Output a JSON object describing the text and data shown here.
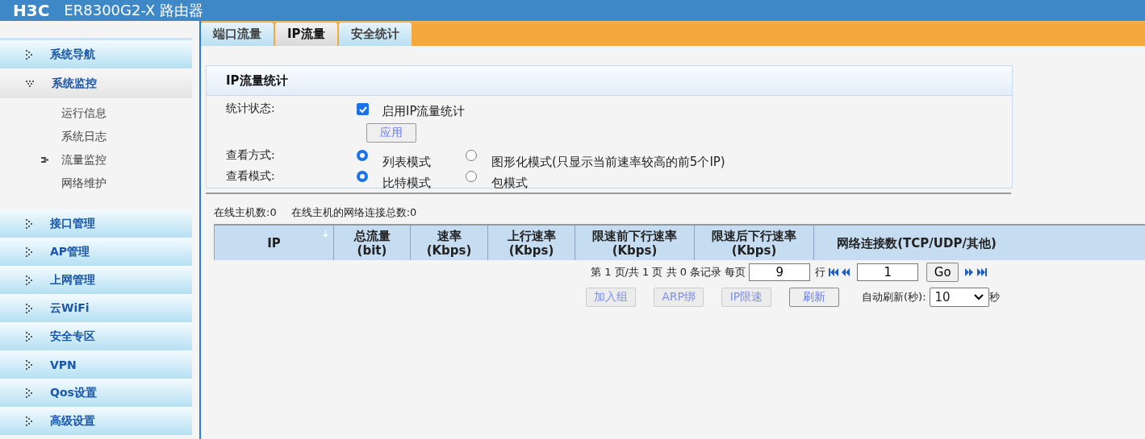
{
  "window": {
    "logo": "H3C",
    "title": "ER8300G2-X 路由器"
  },
  "sidebar": {
    "items": [
      {
        "label": "系统导航",
        "expanded": false
      },
      {
        "label": "系统监控",
        "expanded": true,
        "children": [
          {
            "label": "运行信息",
            "selected": false
          },
          {
            "label": "系统日志",
            "selected": false
          },
          {
            "label": "流量监控",
            "selected": true
          },
          {
            "label": "网络维护",
            "selected": false
          }
        ]
      },
      {
        "label": "接口管理",
        "expanded": false
      },
      {
        "label": "AP管理",
        "expanded": false
      },
      {
        "label": "上网管理",
        "expanded": false
      },
      {
        "label": "云WiFi",
        "expanded": false
      },
      {
        "label": "安全专区",
        "expanded": false
      },
      {
        "label": "VPN",
        "expanded": false
      },
      {
        "label": "Qos设置",
        "expanded": false
      },
      {
        "label": "高级设置",
        "expanded": false
      }
    ]
  },
  "tabs": [
    {
      "label": "端口流量",
      "selected": false
    },
    {
      "label": "IP流量",
      "selected": true
    },
    {
      "label": "安全统计",
      "selected": false
    }
  ],
  "panel": {
    "title": "IP流量统计",
    "rows": [
      {
        "kind": "checkbox",
        "label": "统计状态:",
        "checked": true,
        "option": "启用IP流量统计",
        "button": "应用"
      },
      {
        "kind": "radio",
        "label": "查看方式:",
        "options": [
          {
            "label": "列表模式",
            "selected": true
          },
          {
            "label": "图形化模式(只显示当前速率较高的前5个IP)",
            "selected": false
          }
        ]
      },
      {
        "kind": "radio",
        "label": "查看模式:",
        "options": [
          {
            "label": "比特模式",
            "selected": true
          },
          {
            "label": "包模式",
            "selected": false
          }
        ]
      }
    ]
  },
  "stats": [
    "在线主机数:0",
    "在线主机的网络连接总数:0"
  ],
  "table": {
    "columns": [
      {
        "label": "IP",
        "sorted": true
      },
      {
        "label": "总流量\n(bit)",
        "sorted": false
      },
      {
        "label": "速率\n(Kbps)",
        "sorted": false
      },
      {
        "label": "上行速率\n(Kbps)",
        "sorted": false
      },
      {
        "label": "限速前下行速率\n(Kbps)",
        "sorted": false
      },
      {
        "label": "限速后下行速率\n(Kbps)",
        "sorted": false
      },
      {
        "label": "网络连接数(TCP/UDP/其他)",
        "sorted": false
      }
    ]
  },
  "pager": {
    "summary": "第 1 页/共 1 页 共 0 条记录 每页",
    "rows_per_page": "9",
    "rows_unit": "行",
    "page": "1",
    "go": "Go"
  },
  "actions": [
    {
      "label": "加入组",
      "disabled": true
    },
    {
      "label": "ARP绑",
      "disabled": true
    },
    {
      "label": "IP限速",
      "disabled": true
    },
    {
      "label": "刷新",
      "disabled": false
    }
  ],
  "auto_refresh": {
    "label": "自动刷新(秒):",
    "value": "10",
    "unit": "秒"
  }
}
